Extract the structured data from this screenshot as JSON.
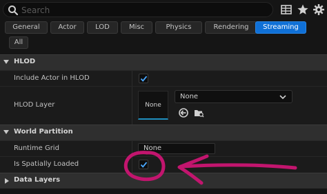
{
  "search": {
    "placeholder": "Search"
  },
  "toolbar": {
    "icons": [
      "table-icon",
      "star-icon",
      "gear-icon"
    ]
  },
  "filters": [
    {
      "label": "General",
      "active": false
    },
    {
      "label": "Actor",
      "active": false
    },
    {
      "label": "LOD",
      "active": false
    },
    {
      "label": "Misc",
      "active": false
    },
    {
      "label": "Physics",
      "active": false
    },
    {
      "label": "Rendering",
      "active": false
    },
    {
      "label": "Streaming",
      "active": true
    },
    {
      "label": "All",
      "active": false
    }
  ],
  "sections": {
    "hlod": {
      "title": "HLOD",
      "include_label": "Include Actor in HLOD",
      "include_checked": true,
      "layer_label": "HLOD Layer",
      "layer_thumb": "None",
      "layer_dropdown": "None"
    },
    "world_partition": {
      "title": "World Partition",
      "grid_label": "Runtime Grid",
      "grid_value": "None",
      "spatial_label": "Is Spatially Loaded",
      "spatial_checked": true
    },
    "data_layers": {
      "title": "Data Layers"
    }
  },
  "colors": {
    "accent": "#0f70d7",
    "annotation": "#c2156e",
    "check": "#4aa8ff"
  }
}
